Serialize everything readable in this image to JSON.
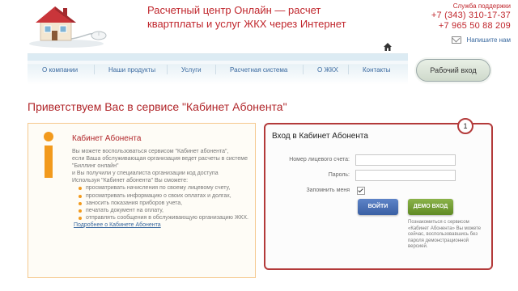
{
  "header": {
    "title_line1": "Расчетный центр Онлайн — расчет",
    "title_line2": "квартплаты и услуг ЖКХ через Интернет",
    "support_label": "Служба поддержки",
    "phone1": "+7 (343) 310-17-37",
    "phone2": "+7 965 50 88 209",
    "write_us": "Напишите нам"
  },
  "nav": {
    "items": [
      "О компании",
      "Наши продукты",
      "Услуги",
      "Расчетная система",
      "О ЖКХ",
      "Контакты"
    ],
    "work_login": "Рабочий вход"
  },
  "welcome": "Приветствуем Вас в сервисе \"Кабинет Абонента\"",
  "left_panel": {
    "title": "Кабинет Абонента",
    "p1": "Вы можете воспользоваться сервисом \"Кабинет абонента\",",
    "p2": "если Ваша обслуживающая организация ведет расчеты в системе \"Биллинг онлайн\"",
    "p3": "и Вы получили у специалиста организации код доступа",
    "p4": "Используя \"Кабинет абонента\" Вы сможете:",
    "bullets": [
      "просматривать начисления по своему лицевому счету,",
      "просматривать информацию о своих оплатах и долгах,",
      "заносить показания приборов учета,",
      "печатать документ на оплату,",
      "отправлять сообщения в обслуживающую организацию ЖКХ."
    ],
    "more_link": "Подробнее о Кабинете Абонента"
  },
  "login_panel": {
    "badge": "1",
    "title": "Вход в Кабинет Абонента",
    "account_label": "Номер лицевого счета:",
    "account_value": "",
    "password_label": "Пароль:",
    "password_value": "",
    "remember_label": "Запомнить меня",
    "remember_checked": true,
    "login_button": "ВОЙТИ",
    "demo_button": "ДЕМО ВХОД",
    "demo_note": "Познакомиться с сервисом «Кабинет Абонента» Вы можете сейчас, воспользовавшись без пароля демонстрационной версией."
  },
  "colors": {
    "accent_red": "#c0272d",
    "link_blue": "#3b6aa0",
    "orange": "#f29a1d",
    "login_blue": "#4a70b8",
    "demo_green": "#74a036"
  },
  "icons": [
    "house-logo-icon",
    "mouse-icon",
    "home-icon",
    "mail-icon",
    "info-icon",
    "checkbox-checked-icon"
  ]
}
